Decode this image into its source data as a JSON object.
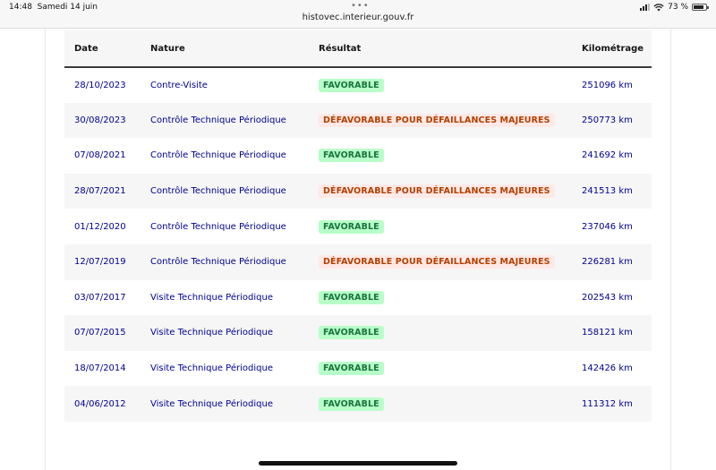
{
  "status_bar": {
    "time": "14:48",
    "date": "Samedi 14 juin",
    "url": "histovec.interieur.gouv.fr",
    "battery": "73 %",
    "menu_dots": "•••"
  },
  "table": {
    "headers": {
      "date": "Date",
      "nature": "Nature",
      "result": "Résultat",
      "mileage": "Kilométrage"
    },
    "rows": [
      {
        "date": "28/10/2023",
        "nature": "Contre-Visite",
        "result": "FAVORABLE",
        "status": "ok",
        "mileage": "251096 km"
      },
      {
        "date": "30/08/2023",
        "nature": "Contrôle Technique Périodique",
        "result": "DÉFAVORABLE POUR DÉFAILLANCES MAJEURES",
        "status": "ko",
        "mileage": "250773 km"
      },
      {
        "date": "07/08/2021",
        "nature": "Contrôle Technique Périodique",
        "result": "FAVORABLE",
        "status": "ok",
        "mileage": "241692 km"
      },
      {
        "date": "28/07/2021",
        "nature": "Contrôle Technique Périodique",
        "result": "DÉFAVORABLE POUR DÉFAILLANCES MAJEURES",
        "status": "ko",
        "mileage": "241513 km"
      },
      {
        "date": "01/12/2020",
        "nature": "Contrôle Technique Périodique",
        "result": "FAVORABLE",
        "status": "ok",
        "mileage": "237046 km"
      },
      {
        "date": "12/07/2019",
        "nature": "Contrôle Technique Périodique",
        "result": "DÉFAVORABLE POUR DÉFAILLANCES MAJEURES",
        "status": "ko",
        "mileage": "226281 km"
      },
      {
        "date": "03/07/2017",
        "nature": "Visite Technique Périodique",
        "result": "FAVORABLE",
        "status": "ok",
        "mileage": "202543 km"
      },
      {
        "date": "07/07/2015",
        "nature": "Visite Technique Périodique",
        "result": "FAVORABLE",
        "status": "ok",
        "mileage": "158121 km"
      },
      {
        "date": "18/07/2014",
        "nature": "Visite Technique Périodique",
        "result": "FAVORABLE",
        "status": "ok",
        "mileage": "142426 km"
      },
      {
        "date": "04/06/2012",
        "nature": "Visite Technique Périodique",
        "result": "FAVORABLE",
        "status": "ok",
        "mileage": "111312 km"
      }
    ]
  },
  "colors": {
    "link_blue": "#000091",
    "favorable_bg": "#b8fec9",
    "favorable_text": "#18753c",
    "defavorable_bg": "#ffe9e6",
    "defavorable_text": "#b34000"
  }
}
